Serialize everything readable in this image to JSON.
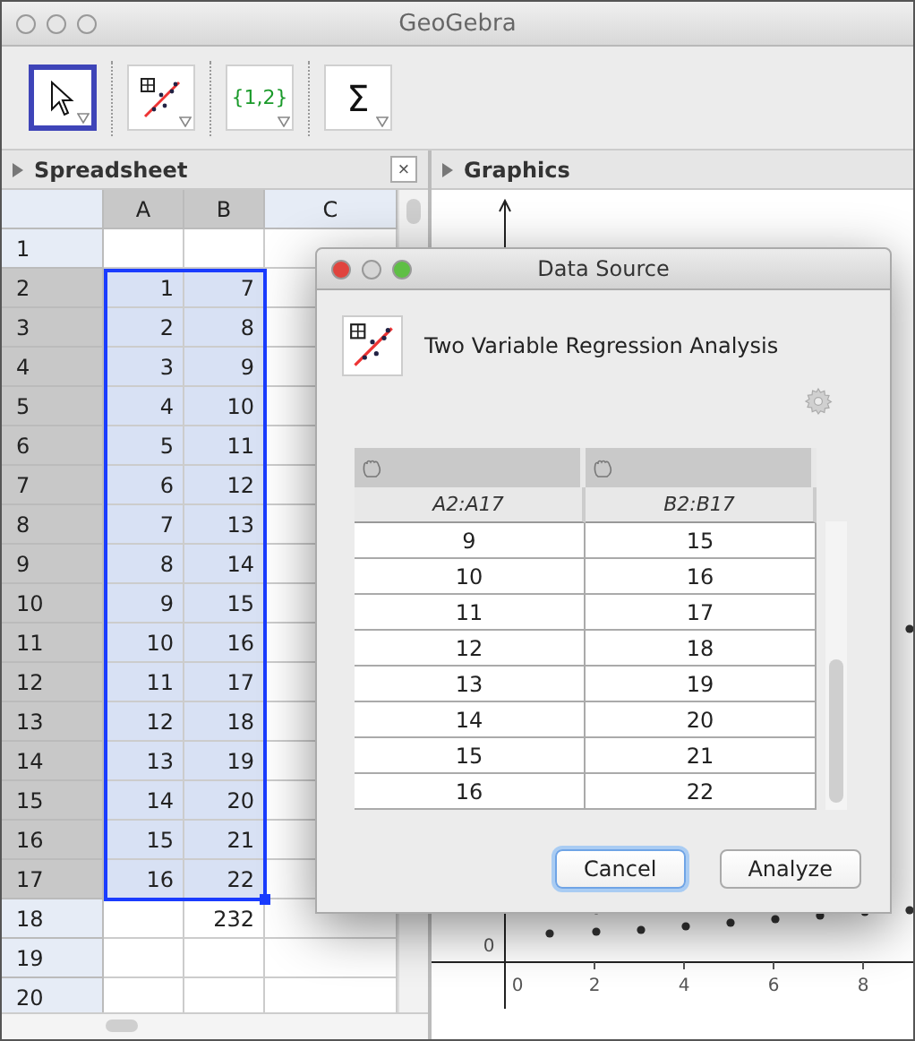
{
  "window": {
    "title": "GeoGebra"
  },
  "toolbar": [
    {
      "kind": "pointer",
      "selected": true
    },
    {
      "kind": "regression",
      "selected": false
    },
    {
      "kind": "list",
      "label": "{1,2}",
      "selected": false
    },
    {
      "kind": "sum",
      "label": "Σ",
      "selected": false
    }
  ],
  "spreadsheet": {
    "title": "Spreadsheet",
    "close": "×",
    "columns": [
      {
        "label": "A",
        "selected": true
      },
      {
        "label": "B",
        "selected": true
      },
      {
        "label": "C",
        "selected": false
      }
    ],
    "rows": [
      {
        "label": "1",
        "selected": false,
        "cells": [
          null,
          null
        ]
      },
      {
        "label": "2",
        "selected": true,
        "cells": [
          "1",
          "7"
        ]
      },
      {
        "label": "3",
        "selected": true,
        "cells": [
          "2",
          "8"
        ]
      },
      {
        "label": "4",
        "selected": true,
        "cells": [
          "3",
          "9"
        ]
      },
      {
        "label": "5",
        "selected": true,
        "cells": [
          "4",
          "10"
        ]
      },
      {
        "label": "6",
        "selected": true,
        "cells": [
          "5",
          "11"
        ]
      },
      {
        "label": "7",
        "selected": true,
        "cells": [
          "6",
          "12"
        ]
      },
      {
        "label": "8",
        "selected": true,
        "cells": [
          "7",
          "13"
        ]
      },
      {
        "label": "9",
        "selected": true,
        "cells": [
          "8",
          "14"
        ]
      },
      {
        "label": "10",
        "selected": true,
        "cells": [
          "9",
          "15"
        ]
      },
      {
        "label": "11",
        "selected": true,
        "cells": [
          "10",
          "16"
        ]
      },
      {
        "label": "12",
        "selected": true,
        "cells": [
          "11",
          "17"
        ]
      },
      {
        "label": "13",
        "selected": true,
        "cells": [
          "12",
          "18"
        ]
      },
      {
        "label": "14",
        "selected": true,
        "cells": [
          "13",
          "19"
        ]
      },
      {
        "label": "15",
        "selected": true,
        "cells": [
          "14",
          "20"
        ]
      },
      {
        "label": "16",
        "selected": true,
        "cells": [
          "15",
          "21"
        ]
      },
      {
        "label": "17",
        "selected": true,
        "cells": [
          "16",
          "22"
        ]
      },
      {
        "label": "18",
        "selected": false,
        "cells": [
          null,
          "232"
        ]
      },
      {
        "label": "19",
        "selected": false,
        "cells": [
          null,
          null
        ]
      },
      {
        "label": "20",
        "selected": false,
        "cells": [
          null,
          null
        ]
      }
    ]
  },
  "graphics": {
    "title": "Graphics",
    "x_tick_labels": [
      "0",
      "2",
      "4",
      "6",
      "8"
    ],
    "y_tick_labels": [
      "0"
    ]
  },
  "dialog": {
    "title": "Data Source",
    "heading": "Two Variable Regression Analysis",
    "columns": [
      "A2:A17",
      "B2:B17"
    ],
    "rows": [
      [
        "9",
        "15"
      ],
      [
        "10",
        "16"
      ],
      [
        "11",
        "17"
      ],
      [
        "12",
        "18"
      ],
      [
        "13",
        "19"
      ],
      [
        "14",
        "20"
      ],
      [
        "15",
        "21"
      ],
      [
        "16",
        "22"
      ]
    ],
    "buttons": [
      {
        "label": "Cancel",
        "focused": true
      },
      {
        "label": "Analyze",
        "focused": false
      }
    ]
  }
}
